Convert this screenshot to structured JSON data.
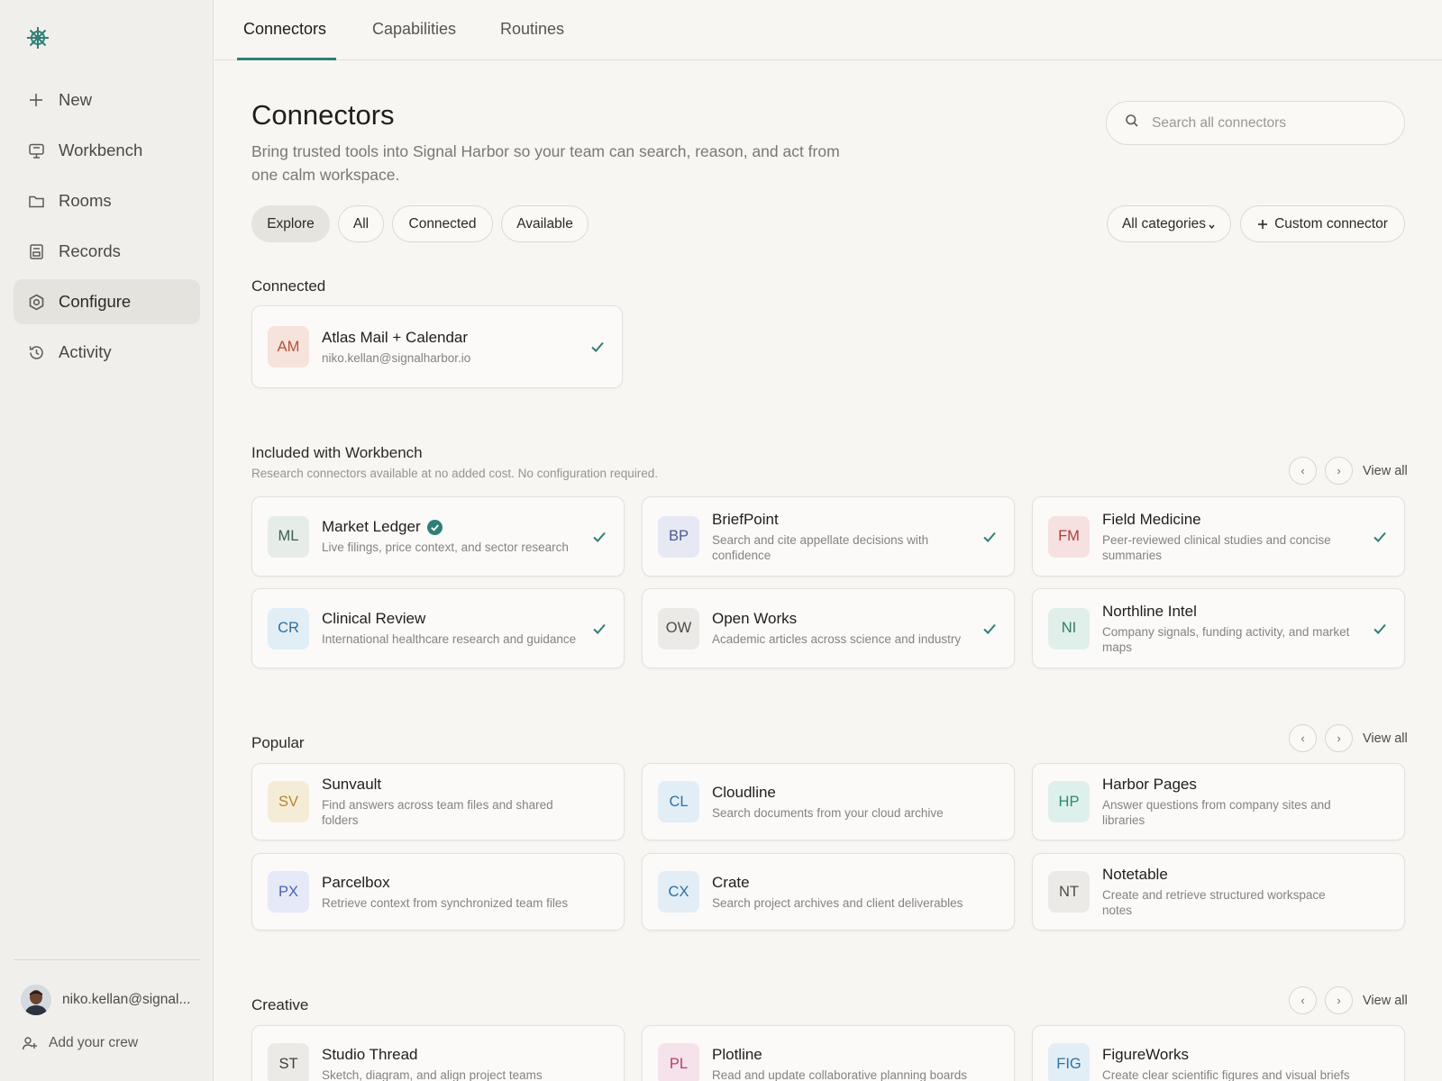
{
  "sidebar": {
    "items": [
      {
        "label": "New",
        "icon": "plus-icon"
      },
      {
        "label": "Workbench",
        "icon": "monitor-icon"
      },
      {
        "label": "Rooms",
        "icon": "folder-icon"
      },
      {
        "label": "Records",
        "icon": "document-icon"
      },
      {
        "label": "Configure",
        "icon": "gear-icon",
        "active": true
      },
      {
        "label": "Activity",
        "icon": "history-icon"
      }
    ],
    "user_email": "niko.kellan@signal...",
    "add_crew": "Add your crew"
  },
  "tabs": [
    {
      "label": "Connectors",
      "active": true
    },
    {
      "label": "Capabilities"
    },
    {
      "label": "Routines"
    }
  ],
  "header": {
    "title": "Connectors",
    "description": "Bring trusted tools into Signal Harbor so your team can search, reason, and act from one calm workspace.",
    "search_placeholder": "Search all connectors"
  },
  "filters": [
    "Explore",
    "All",
    "Connected",
    "Available"
  ],
  "active_filter": "Explore",
  "category_select": "All categories",
  "custom_connector": "Custom connector",
  "view_all": "View all",
  "connected": {
    "title": "Connected",
    "cards": [
      {
        "abbr": "AM",
        "name": "Atlas Mail + Calendar",
        "desc": "niko.kellan@signalharbor.io",
        "checked": true,
        "bg": "#f6e3dc",
        "fg": "#b5503a"
      }
    ]
  },
  "included": {
    "title": "Included with Workbench",
    "subtitle": "Research connectors available at no added cost. No configuration required.",
    "cards": [
      {
        "abbr": "ML",
        "name": "Market Ledger",
        "desc": "Live filings, price context, and sector research",
        "checked": true,
        "verified": true,
        "bg": "#e6ece8",
        "fg": "#3d5f4f"
      },
      {
        "abbr": "BP",
        "name": "BriefPoint",
        "desc": "Search and cite appellate decisions with confidence",
        "checked": true,
        "bg": "#e6e9f3",
        "fg": "#4a5a8e"
      },
      {
        "abbr": "FM",
        "name": "Field Medicine",
        "desc": "Peer-reviewed clinical studies and concise summaries",
        "checked": true,
        "bg": "#f6e0e0",
        "fg": "#b23b3b"
      },
      {
        "abbr": "CR",
        "name": "Clinical Review",
        "desc": "International healthcare research and guidance",
        "checked": true,
        "bg": "#e2eef6",
        "fg": "#2f6f9b"
      },
      {
        "abbr": "OW",
        "name": "Open Works",
        "desc": "Academic articles across science and industry",
        "checked": true,
        "bg": "#ebeae7",
        "fg": "#4d4b47"
      },
      {
        "abbr": "NI",
        "name": "Northline Intel",
        "desc": "Company signals, funding activity, and market maps",
        "checked": true,
        "bg": "#e0efea",
        "fg": "#2d7f69"
      }
    ]
  },
  "popular": {
    "title": "Popular",
    "cards": [
      {
        "abbr": "SV",
        "name": "Sunvault",
        "desc": "Find answers across team files and shared folders",
        "bg": "#f5ecd8",
        "fg": "#b3872a"
      },
      {
        "abbr": "CL",
        "name": "Cloudline",
        "desc": "Search documents from your cloud archive",
        "bg": "#e2eef6",
        "fg": "#2f72a3"
      },
      {
        "abbr": "HP",
        "name": "Harbor Pages",
        "desc": "Answer questions from company sites and libraries",
        "bg": "#def0ec",
        "fg": "#2a8a73"
      },
      {
        "abbr": "PX",
        "name": "Parcelbox",
        "desc": "Retrieve context from synchronized team files",
        "bg": "#e5e9f8",
        "fg": "#4d62b5"
      },
      {
        "abbr": "CX",
        "name": "Crate",
        "desc": "Search project archives and client deliverables",
        "bg": "#e2edf6",
        "fg": "#2f6fa0"
      },
      {
        "abbr": "NT",
        "name": "Notetable",
        "desc": "Create and retrieve structured workspace notes",
        "bg": "#ebeae7",
        "fg": "#4d4b47"
      }
    ]
  },
  "creative": {
    "title": "Creative",
    "cards": [
      {
        "abbr": "ST",
        "name": "Studio Thread",
        "desc": "Sketch, diagram, and align project teams",
        "bg": "#ebeae7",
        "fg": "#3f3e3a"
      },
      {
        "abbr": "PL",
        "name": "Plotline",
        "desc": "Read and update collaborative planning boards",
        "bg": "#f6e2ea",
        "fg": "#b23e6c"
      },
      {
        "abbr": "FIG",
        "name": "FigureWorks",
        "desc": "Create clear scientific figures and visual briefs",
        "bg": "#e2eef6",
        "fg": "#2f72a3"
      }
    ]
  }
}
